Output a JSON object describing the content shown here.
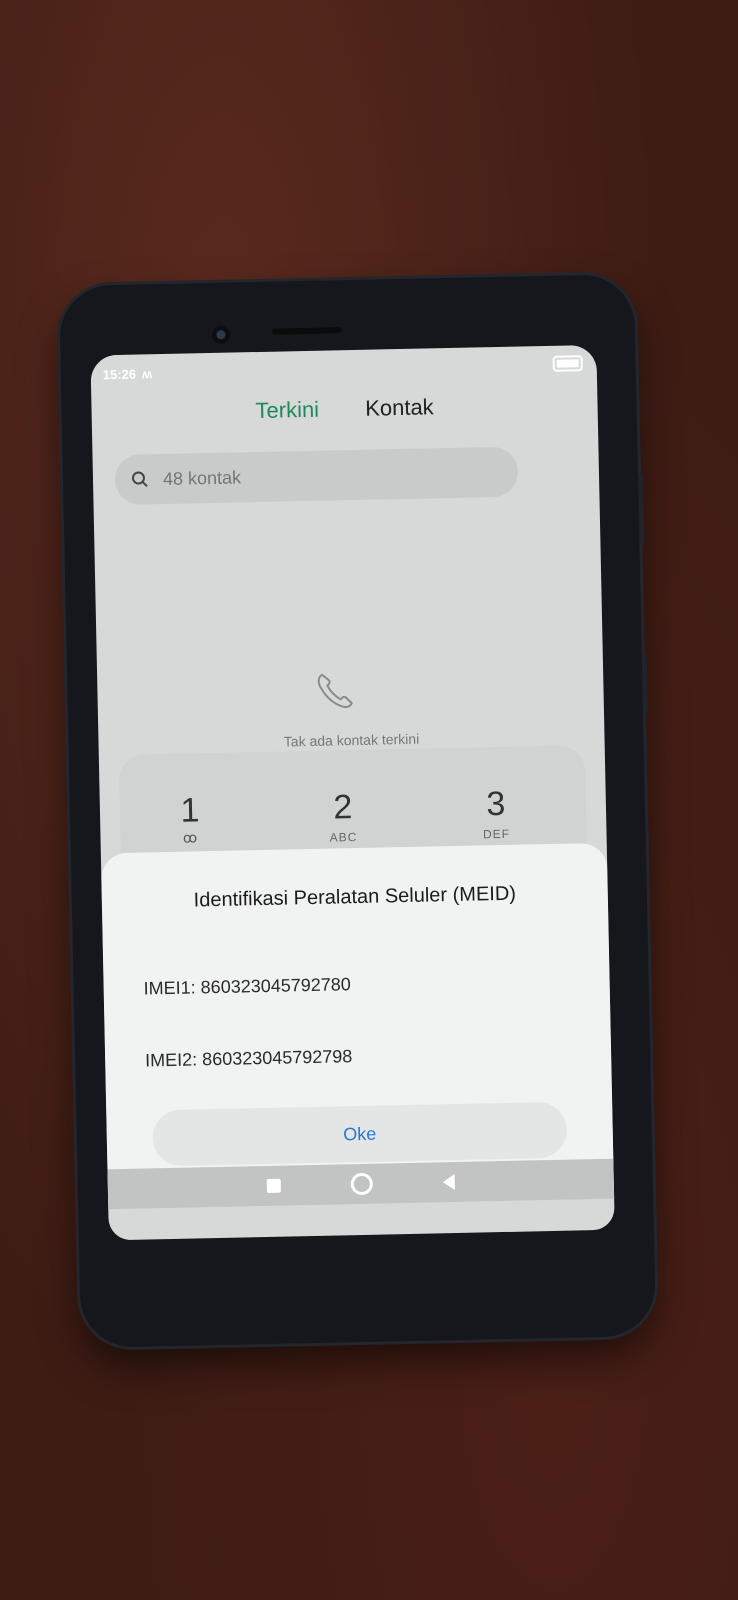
{
  "status_bar": {
    "time": "15:26",
    "notification_icon": "m-icon"
  },
  "tabs": [
    {
      "label": "Terkini",
      "active": true
    },
    {
      "label": "Kontak",
      "active": false
    }
  ],
  "search": {
    "placeholder": "48 kontak"
  },
  "empty_state": {
    "icon": "phone-handset-icon",
    "text": "Tak ada kontak terkini"
  },
  "keypad": {
    "keys": [
      {
        "digit": "1",
        "letters": "ꝏ"
      },
      {
        "digit": "2",
        "letters": "ABC"
      },
      {
        "digit": "3",
        "letters": "DEF"
      }
    ]
  },
  "dialog": {
    "title": "Identifikasi Peralatan Seluler (MEID)",
    "imei1": "IMEI1: 860323045792780",
    "imei2": "IMEI2: 860323045792798",
    "ok_label": "Oke"
  },
  "colors": {
    "active_tab": "#1e8a5a",
    "ok_button_text": "#2a78d4"
  }
}
